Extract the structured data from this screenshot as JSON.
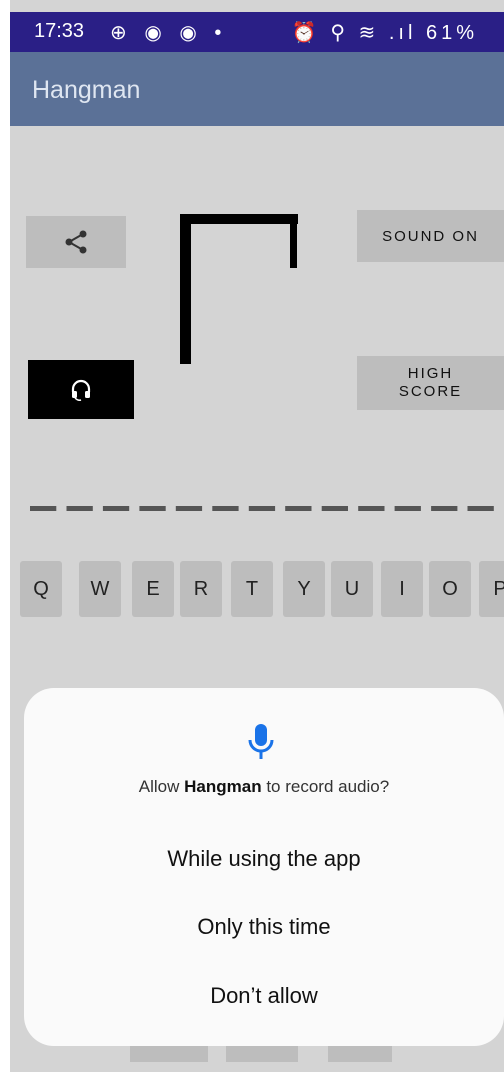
{
  "status_bar": {
    "time": "17:33",
    "left_icons": "⊕ ◉ ◉ •",
    "right_icons": "⏰ ⚲ ≋ .ıl",
    "battery": "61%"
  },
  "app": {
    "title": "Hangman"
  },
  "buttons": {
    "share_icon": "share-icon",
    "sound_label": "SOUND ON",
    "highscore_label": "HIGH\nSCORE",
    "audio_icon": "headset-icon"
  },
  "word": {
    "blank_count": 13
  },
  "keyboard": {
    "row": [
      "Q",
      "W",
      "E",
      "R",
      "T",
      "Y",
      "U",
      "I",
      "O",
      "P"
    ]
  },
  "dialog": {
    "icon": "microphone-icon",
    "question_prefix": "Allow ",
    "question_app": "Hangman",
    "question_suffix": " to record audio?",
    "option_while_using": "While using the app",
    "option_once": "Only this time",
    "option_deny": "Don’t allow"
  },
  "colors": {
    "status_bar": "#2a1f86",
    "app_bar": "#5b7197",
    "background": "#d4d4d4",
    "button": "#bdbdbd",
    "accent_mic": "#1a73e8"
  }
}
